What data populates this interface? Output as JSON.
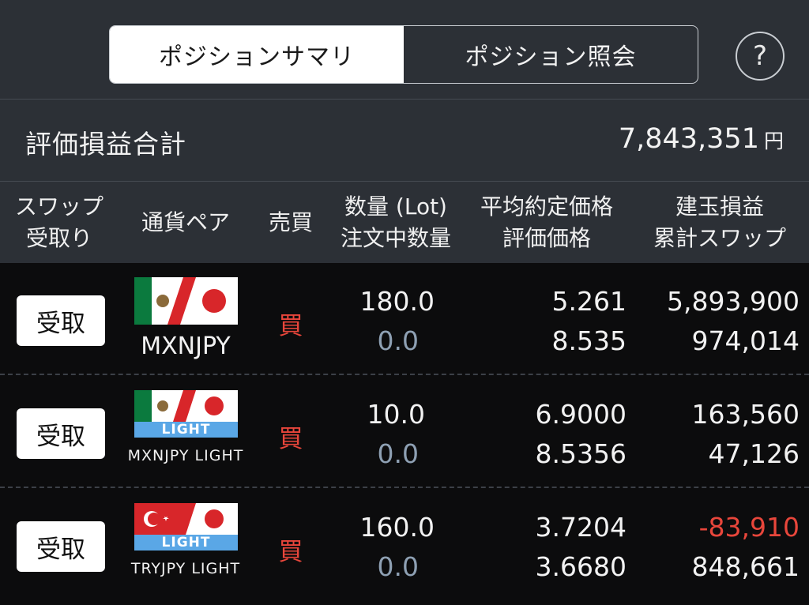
{
  "tabs": {
    "summary": "ポジションサマリ",
    "inquiry": "ポジション照会"
  },
  "help_label": "?",
  "summary": {
    "label": "評価損益合計",
    "value": "7,843,351",
    "unit": "円"
  },
  "columns": {
    "swap_line1": "スワップ",
    "swap_line2": "受取り",
    "pair": "通貨ペア",
    "side": "売買",
    "qty_line1": "数量 (Lot)",
    "qty_line2": "注文中数量",
    "price_line1": "平均約定価格",
    "price_line2": "評価価格",
    "pnl_line1": "建玉損益",
    "pnl_line2": "累計スワップ"
  },
  "rows": [
    {
      "receive_label": "受取",
      "pair": "MXNJPY",
      "badge": "",
      "side": "買",
      "qty": "180.0",
      "order_qty": "0.0",
      "avg_price": "5.261",
      "eval_price": "8.535",
      "pnl": "5,893,900",
      "swap": "974,014",
      "pnl_negative": false
    },
    {
      "receive_label": "受取",
      "pair": "MXNJPY LIGHT",
      "badge": "LIGHT",
      "side": "買",
      "qty": "10.0",
      "order_qty": "0.0",
      "avg_price": "6.9000",
      "eval_price": "8.5356",
      "pnl": "163,560",
      "swap": "47,126",
      "pnl_negative": false
    },
    {
      "receive_label": "受取",
      "pair": "TRYJPY LIGHT",
      "badge": "LIGHT",
      "side": "買",
      "qty": "160.0",
      "order_qty": "0.0",
      "avg_price": "3.7204",
      "eval_price": "3.6680",
      "pnl": "-83,910",
      "swap": "848,661",
      "pnl_negative": true
    }
  ],
  "colors": {
    "header_bg": "#2c3036",
    "row_bg": "#0c0c0d",
    "buy_red": "#e8463b",
    "muted_blue_gray": "#8ea0b3",
    "light_badge_blue": "#5aa7e6",
    "mexico_green": "#0b7a3e",
    "japan_red": "#d8262a",
    "turkey_red": "#d8262a"
  },
  "icons": {
    "help": "question-circle-icon",
    "mx_jp": "mexico-japan-flag-icon",
    "tr_jp": "turkey-japan-flag-icon"
  }
}
